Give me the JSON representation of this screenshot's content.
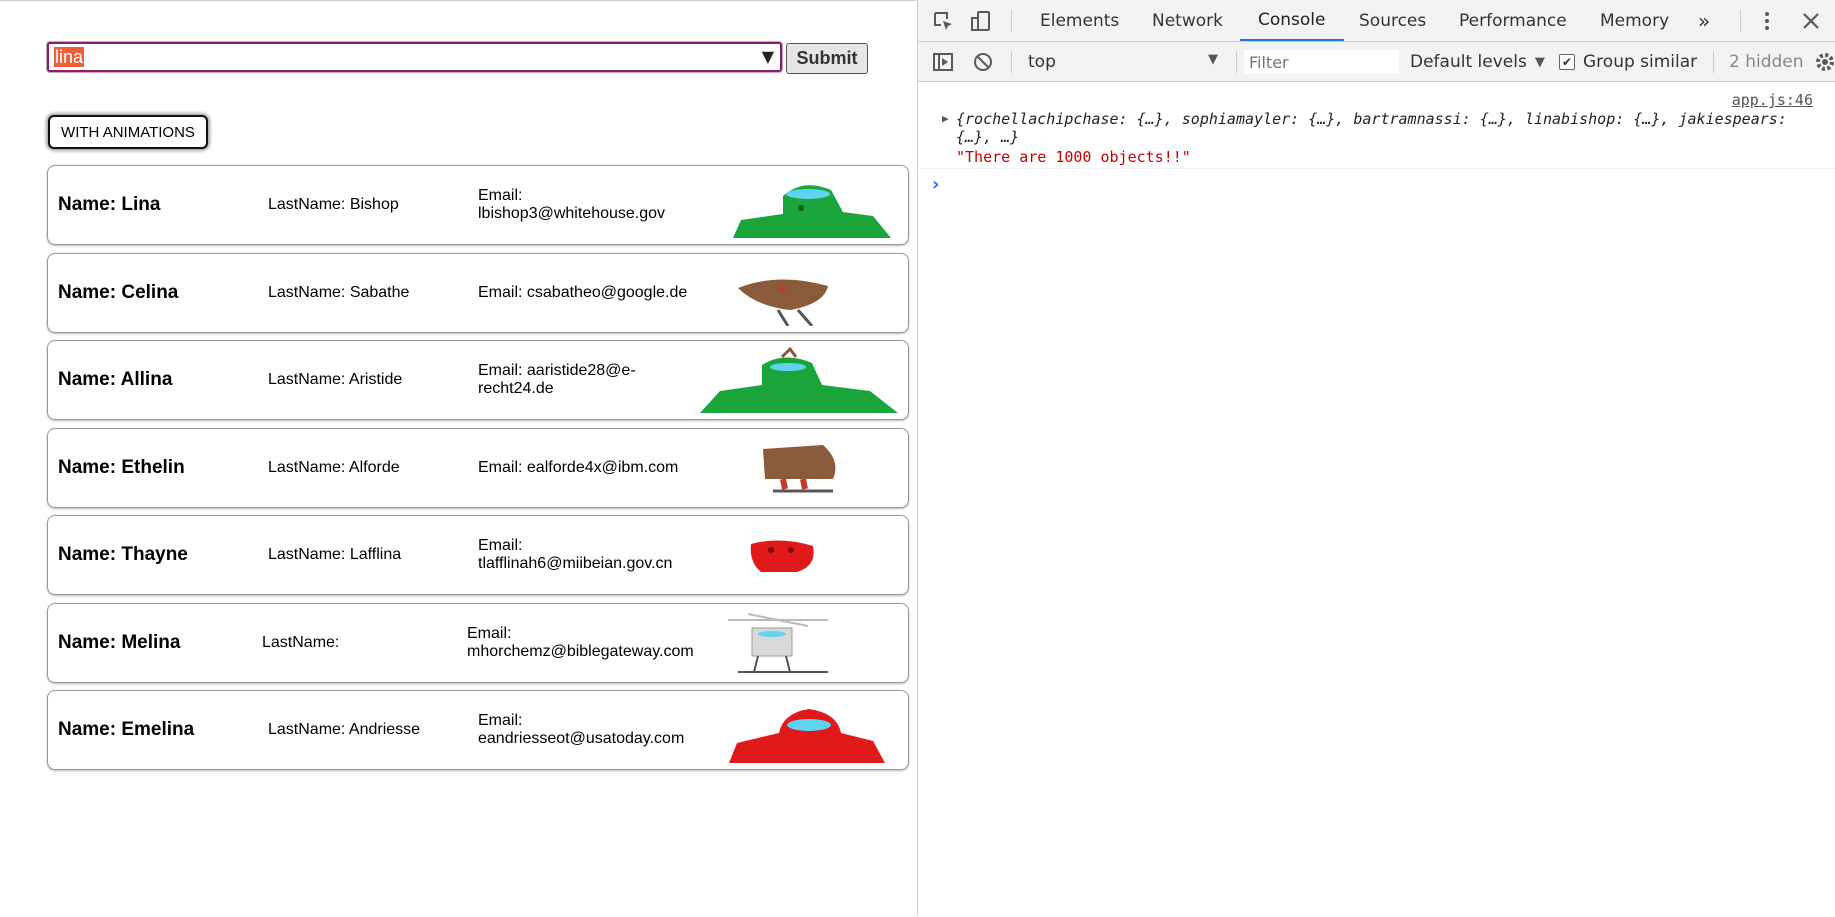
{
  "search": {
    "value": "lina",
    "dropdown_icon": "triangle-down-icon"
  },
  "submit_label": "Submit",
  "animations_label": "WITH ANIMATIONS",
  "people": [
    {
      "name": "Name: Lina",
      "lastname": "LastName: Bishop",
      "email": "Email: lbishop3@whitehouse.gov",
      "robot_color": "#1aa53a",
      "robot_icon": "robot-avatar-icon"
    },
    {
      "name": "Name: Celina",
      "lastname": "LastName: Sabathe",
      "email": "Email: csabatheo@google.de",
      "robot_color": "#8a5a3a",
      "robot_icon": "robot-avatar-icon"
    },
    {
      "name": "Name: Allina",
      "lastname": "LastName: Aristide",
      "email": "Email: aaristide28@e-recht24.de",
      "robot_color": "#1aa53a",
      "robot_icon": "robot-avatar-icon"
    },
    {
      "name": "Name: Ethelin",
      "lastname": "LastName: Alforde",
      "email": "Email: ealforde4x@ibm.com",
      "robot_color": "#8a5a3a",
      "robot_icon": "robot-avatar-icon"
    },
    {
      "name": "Name: Thayne",
      "lastname": "LastName: Lafflina",
      "email": "Email: tlafflinah6@miibeian.gov.cn",
      "robot_color": "#e01a1a",
      "robot_icon": "robot-avatar-icon"
    },
    {
      "name": "Name: Melina",
      "lastname": "LastName:",
      "email": "Email: mhorchemz@biblegateway.com",
      "robot_color": "#cfcfcf",
      "robot_icon": "robot-avatar-icon"
    },
    {
      "name": "Name: Emelina",
      "lastname": "LastName: Andriesse",
      "email": "Email: eandriesseot@usatoday.com",
      "robot_color": "#e01a1a",
      "robot_icon": "robot-avatar-icon"
    }
  ],
  "devtools": {
    "tabs": [
      "Elements",
      "Network",
      "Console",
      "Sources",
      "Performance",
      "Memory"
    ],
    "active_tab": "Console",
    "more_tabs": "»",
    "context": "top",
    "filter_placeholder": "Filter",
    "levels": "Default levels",
    "group_similar": "Group similar",
    "group_similar_checked": true,
    "hidden": "2 hidden",
    "source_link": "app.js:46",
    "object_preview": "{rochellachipchase: {…}, sophiamayler: {…}, bartramnassi: {…}, linabishop: {…}, jakiespears: {…}, …}",
    "string_message": "\"There are 1000 objects!!\"",
    "prompt": "›",
    "accent_color": "#1a73e8"
  }
}
